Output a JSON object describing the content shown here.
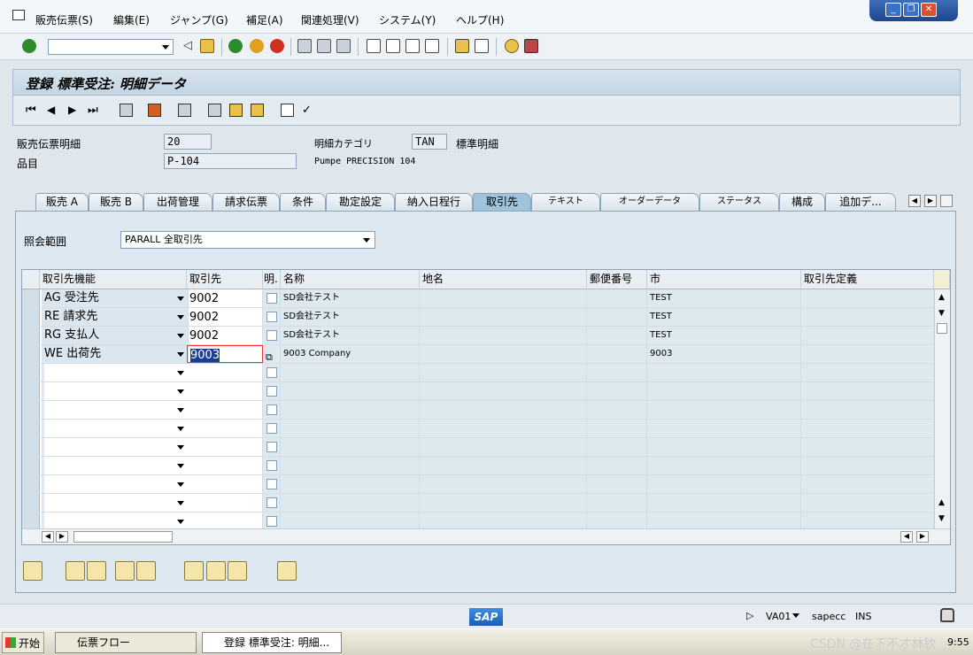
{
  "menu": [
    "販売伝票(S)",
    "編集(E)",
    "ジャンプ(G)",
    "補足(A)",
    "関連処理(V)",
    "システム(Y)",
    "ヘルプ(H)"
  ],
  "title": "登録 標準受注: 明細データ",
  "header": {
    "item_label": "販売伝票明細",
    "item_value": "20",
    "category_label": "明細カテゴリ",
    "category_value": "TAN",
    "category_text": "標準明細",
    "material_label": "品目",
    "material_value": "P-104",
    "material_text": "Pumpe PRECISION 104"
  },
  "tabs": [
    "販売 A",
    "販売 B",
    "出荷管理",
    "請求伝票",
    "条件",
    "勘定設定",
    "納入日程行",
    "取引先",
    "テキスト",
    "オーダーデータ",
    "ステータス",
    "構成",
    "追加デ..."
  ],
  "active_tab": "取引先",
  "scope": {
    "label": "照会範囲",
    "value": "PARALL 全取引先"
  },
  "table": {
    "headers": [
      "取引先機能",
      "取引先",
      "明.",
      "名称",
      "地名",
      "郵便番号",
      "市",
      "取引先定義"
    ],
    "rows": [
      {
        "function": "AG 受注先",
        "partner": "9002",
        "name": "SD会社テスト",
        "city": "TEST"
      },
      {
        "function": "RE 請求先",
        "partner": "9002",
        "name": "SD会社テスト",
        "city": "TEST"
      },
      {
        "function": "RG 支払人",
        "partner": "9002",
        "name": "SD会社テスト",
        "city": "TEST"
      },
      {
        "function": "WE 出荷先",
        "partner": "9003",
        "name": "9003 Company",
        "city": "9003"
      }
    ],
    "empty_rows": 9
  },
  "status": {
    "sap": "SAP",
    "tcode": "VA01",
    "server": "sapecc",
    "mode": "INS"
  },
  "taskbar": {
    "start": "开始",
    "task1": "伝票フロー",
    "task2": "登録 標準受注: 明細...",
    "time": "9:55",
    "watermark": "CSDN @在下不才林钦"
  }
}
